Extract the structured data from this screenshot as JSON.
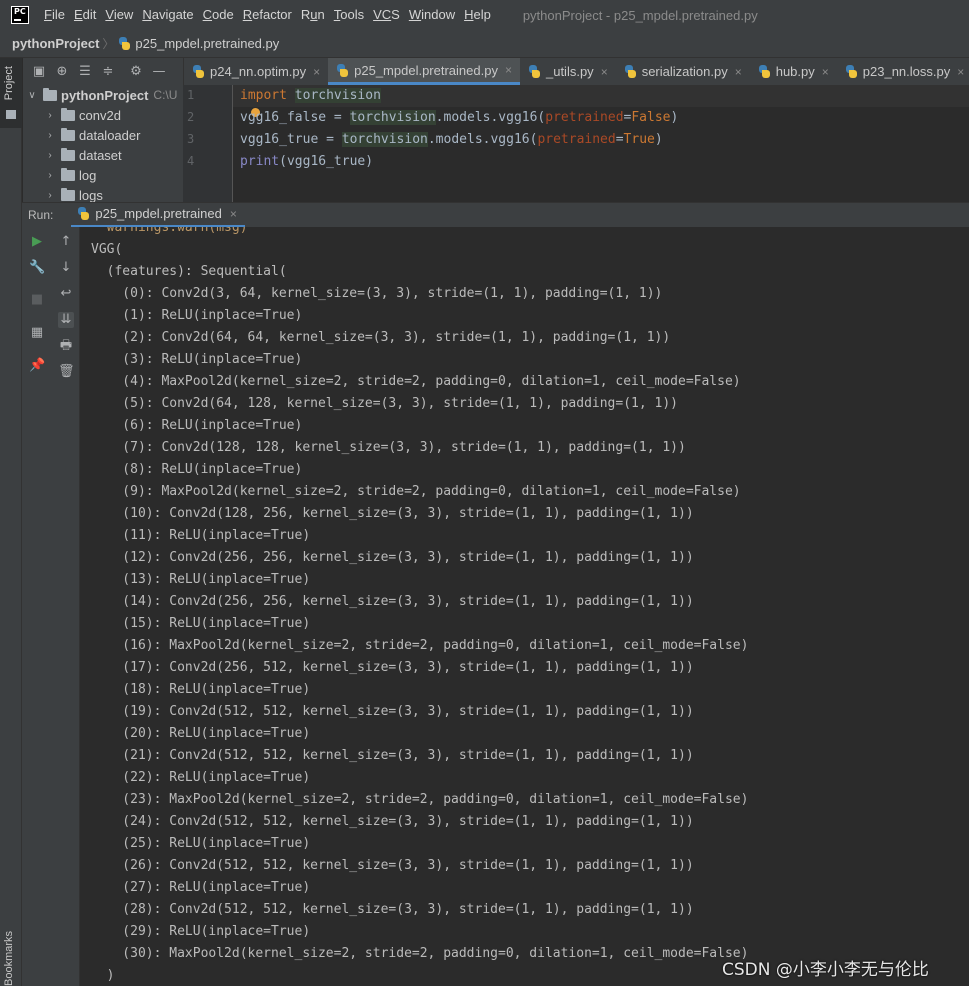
{
  "menu": {
    "logo": "PC",
    "items": [
      {
        "first": "F",
        "rest": "ile"
      },
      {
        "first": "E",
        "rest": "dit"
      },
      {
        "first": "V",
        "rest": "iew"
      },
      {
        "first": "N",
        "rest": "avigate"
      },
      {
        "first": "C",
        "rest": "ode"
      },
      {
        "first": "R",
        "rest": "efactor"
      },
      {
        "first": "R",
        "rest": "un",
        "split": "u"
      },
      {
        "first": "T",
        "rest": "ools"
      },
      {
        "first": "VC",
        "rest": "S"
      },
      {
        "first": "W",
        "rest": "indow"
      },
      {
        "first": "H",
        "rest": "elp"
      }
    ],
    "window_title": "pythonProject - p25_mpdel.pretrained.py"
  },
  "nav": {
    "project": "pythonProject",
    "separator": "〉",
    "file": "p25_mpdel.pretrained.py"
  },
  "left_strip": {
    "project_label": "Project",
    "bookmarks_label": "Bookmarks"
  },
  "project_tree": {
    "root": {
      "name": "pythonProject",
      "path": "C:\\U"
    },
    "items": [
      "conv2d",
      "dataloader",
      "dataset",
      "log",
      "logs"
    ]
  },
  "editor_tabs": [
    {
      "label": "p24_nn.optim.py",
      "active": false
    },
    {
      "label": "p25_mpdel.pretrained.py",
      "active": true
    },
    {
      "label": "_utils.py",
      "active": false
    },
    {
      "label": "serialization.py",
      "active": false
    },
    {
      "label": "hub.py",
      "active": false
    },
    {
      "label": "p23_nn.loss.py",
      "active": false
    }
  ],
  "editor": {
    "line_numbers": [
      "1",
      "2",
      "3",
      "4"
    ],
    "line1": {
      "kw": "import",
      "module": "torchvision"
    },
    "line2": {
      "var": "vgg16_false",
      "eq": " = ",
      "module": "torchvision",
      "call": ".models.vgg16(",
      "param": "pretrained",
      "assign": "=",
      "value": "False",
      "close": ")"
    },
    "line3": {
      "var": "vgg16_true",
      "eq": " = ",
      "module": "torchvision",
      "call": ".models.vgg16(",
      "param": "pretrained",
      "assign": "=",
      "value": "True",
      "close": ")"
    },
    "line4": {
      "fn": "print",
      "args": "(vgg16_true)"
    }
  },
  "run": {
    "label": "Run:",
    "tab_label": "p25_mpdel.pretrained"
  },
  "console": {
    "lines": [
      "  warnings.warn(msg)",
      "VGG(",
      "  (features): Sequential(",
      "    (0): Conv2d(3, 64, kernel_size=(3, 3), stride=(1, 1), padding=(1, 1))",
      "    (1): ReLU(inplace=True)",
      "    (2): Conv2d(64, 64, kernel_size=(3, 3), stride=(1, 1), padding=(1, 1))",
      "    (3): ReLU(inplace=True)",
      "    (4): MaxPool2d(kernel_size=2, stride=2, padding=0, dilation=1, ceil_mode=False)",
      "    (5): Conv2d(64, 128, kernel_size=(3, 3), stride=(1, 1), padding=(1, 1))",
      "    (6): ReLU(inplace=True)",
      "    (7): Conv2d(128, 128, kernel_size=(3, 3), stride=(1, 1), padding=(1, 1))",
      "    (8): ReLU(inplace=True)",
      "    (9): MaxPool2d(kernel_size=2, stride=2, padding=0, dilation=1, ceil_mode=False)",
      "    (10): Conv2d(128, 256, kernel_size=(3, 3), stride=(1, 1), padding=(1, 1))",
      "    (11): ReLU(inplace=True)",
      "    (12): Conv2d(256, 256, kernel_size=(3, 3), stride=(1, 1), padding=(1, 1))",
      "    (13): ReLU(inplace=True)",
      "    (14): Conv2d(256, 256, kernel_size=(3, 3), stride=(1, 1), padding=(1, 1))",
      "    (15): ReLU(inplace=True)",
      "    (16): MaxPool2d(kernel_size=2, stride=2, padding=0, dilation=1, ceil_mode=False)",
      "    (17): Conv2d(256, 512, kernel_size=(3, 3), stride=(1, 1), padding=(1, 1))",
      "    (18): ReLU(inplace=True)",
      "    (19): Conv2d(512, 512, kernel_size=(3, 3), stride=(1, 1), padding=(1, 1))",
      "    (20): ReLU(inplace=True)",
      "    (21): Conv2d(512, 512, kernel_size=(3, 3), stride=(1, 1), padding=(1, 1))",
      "    (22): ReLU(inplace=True)",
      "    (23): MaxPool2d(kernel_size=2, stride=2, padding=0, dilation=1, ceil_mode=False)",
      "    (24): Conv2d(512, 512, kernel_size=(3, 3), stride=(1, 1), padding=(1, 1))",
      "    (25): ReLU(inplace=True)",
      "    (26): Conv2d(512, 512, kernel_size=(3, 3), stride=(1, 1), padding=(1, 1))",
      "    (27): ReLU(inplace=True)",
      "    (28): Conv2d(512, 512, kernel_size=(3, 3), stride=(1, 1), padding=(1, 1))",
      "    (29): ReLU(inplace=True)",
      "    (30): MaxPool2d(kernel_size=2, stride=2, padding=0, dilation=1, ceil_mode=False)",
      "  )"
    ]
  },
  "watermark": "CSDN @小李小李无与伦比",
  "colors": {
    "background": "#2b2b2b",
    "chrome": "#3c3f41",
    "keyword": "#cc7832",
    "builtin": "#8888c6",
    "param": "#aa4926",
    "accent": "#4a88c7",
    "run_green": "#499c54"
  },
  "icons": {
    "logo": "pycharm-logo-icon",
    "tree_arrow": "chevron-right-icon",
    "folder": "folder-icon",
    "python_file": "python-file-icon"
  }
}
